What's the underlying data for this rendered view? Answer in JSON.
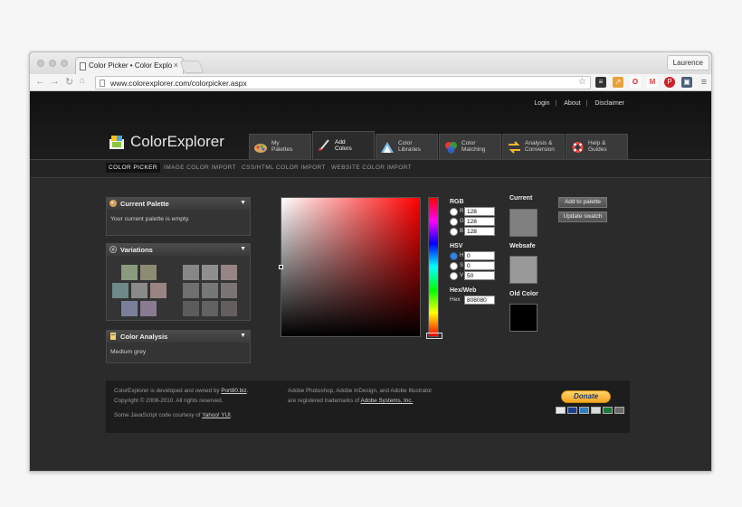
{
  "browser": {
    "tab_title": "Color Picker • Color Explo",
    "tab_close": "×",
    "profile": "Laurence",
    "url": "www.colorexplorer.com/colorpicker.aspx"
  },
  "header": {
    "links": [
      "Login",
      "About",
      "Disclaimer"
    ],
    "logo_parts": [
      "Color",
      "Explorer"
    ],
    "tabs": [
      {
        "line1": "My",
        "line2": "Palettes"
      },
      {
        "line1": "Add",
        "line2": "Colors"
      },
      {
        "line1": "Color",
        "line2": "Libraries"
      },
      {
        "line1": "Color",
        "line2": "Matching"
      },
      {
        "line1": "Analysis &",
        "line2": "Conversion"
      },
      {
        "line1": "Help &",
        "line2": "Guides"
      }
    ],
    "active_tab": 1
  },
  "subnav": [
    "COLOR PICKER",
    "IMAGE COLOR IMPORT",
    "CSS/HTML COLOR IMPORT",
    "WEBSITE COLOR IMPORT"
  ],
  "panels": {
    "current_palette": {
      "title": "Current Palette",
      "text": "Your current palette is empty."
    },
    "variations": {
      "title": "Variations"
    },
    "color_analysis": {
      "title": "Color Analysis",
      "text": "Medium grey"
    }
  },
  "picker": {
    "rgb_label": "RGB",
    "rgb": [
      {
        "key": "R",
        "value": "128"
      },
      {
        "key": "G",
        "value": "128"
      },
      {
        "key": "B",
        "value": "128"
      }
    ],
    "hsv_label": "HSV",
    "hsv": [
      {
        "key": "H",
        "value": "0"
      },
      {
        "key": "S",
        "value": "0"
      },
      {
        "key": "V",
        "value": "50"
      }
    ],
    "hexweb_label": "Hex/Web",
    "hex_key": "Hex",
    "hex_value": "808080",
    "current_label": "Current",
    "websafe_label": "Websafe",
    "old_label": "Old Color",
    "colors": {
      "current": "#808080",
      "websafe": "#999999",
      "old": "#000000"
    },
    "add_button": "Add to palette",
    "update_button": "Update swatch"
  },
  "footer": {
    "left1_pre": "ColorExplorer is developed and owned by ",
    "left1_link": "Port80.biz",
    "left1_post": ".",
    "left2": "Copyright © 2008-2010. All rights reserved.",
    "left3_pre": "Some JavaScript code courtesy of ",
    "left3_link": "Yahoo! YUI",
    "left3_post": ".",
    "mid1": "Adobe Photoshop, Adobe InDesign, and Adobe Illustrator",
    "mid2_pre": "are registered trademarks of ",
    "mid2_link": "Adobe Systems, Inc.",
    "donate": "Donate"
  }
}
